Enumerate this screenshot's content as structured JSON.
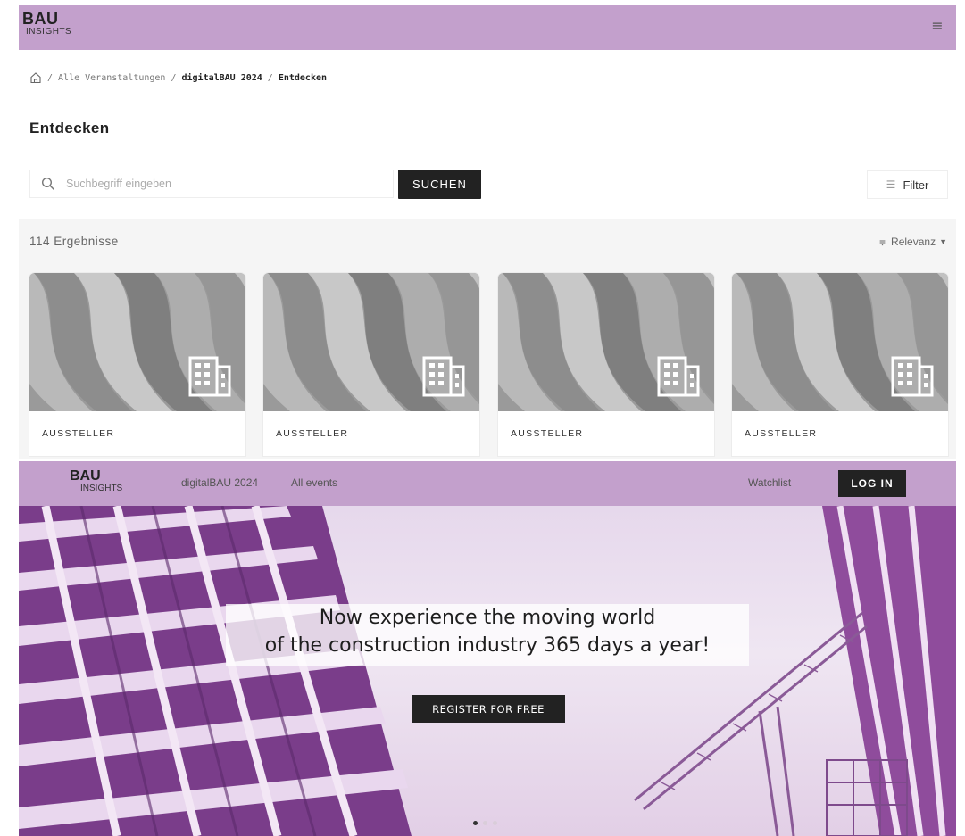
{
  "top": {
    "brand": {
      "line1": "BAU",
      "line2": "INSIGHTS"
    },
    "menu_icon": "hamburger-icon",
    "breadcrumb": {
      "home_icon": "home-icon",
      "separator": "/",
      "items": [
        "Alle Veranstaltungen",
        "digitalBAU 2024",
        "Entdecken"
      ]
    },
    "page_title": "Entdecken",
    "search": {
      "placeholder": "Suchbegriff eingeben",
      "value": "",
      "button_label": "SUCHEN"
    },
    "filter": {
      "label": "Filter",
      "icon": "sliders-icon"
    },
    "results": {
      "count_label": "114 Ergebnisse",
      "sort_label": "Relevanz",
      "cards": [
        {
          "category": "AUSSTELLER",
          "icon": "building-icon"
        },
        {
          "category": "AUSSTELLER",
          "icon": "building-icon"
        },
        {
          "category": "AUSSTELLER",
          "icon": "building-icon"
        },
        {
          "category": "AUSSTELLER",
          "icon": "building-icon"
        }
      ]
    }
  },
  "bottom": {
    "brand": {
      "line1": "BAU",
      "line2": "INSIGHTS"
    },
    "nav": {
      "event": "digitalBAU 2024",
      "all_events": "All events",
      "watchlist": "Watchlist",
      "login": "LOG IN"
    },
    "hero": {
      "headline_line1": "Now experience the moving world",
      "headline_line2": "of the construction industry 365 days a year!",
      "cta": "REGISTER FOR FREE",
      "slides": 3,
      "active_slide": 1
    }
  },
  "colors": {
    "header_bg": "#c3a0cc",
    "button_bg": "#222222",
    "results_bg": "#f5f5f5"
  }
}
